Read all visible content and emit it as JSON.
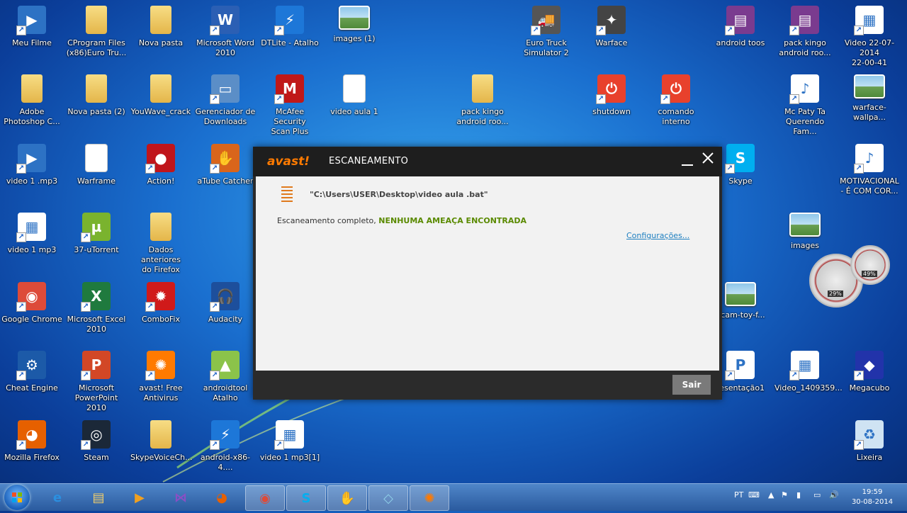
{
  "desktop": {
    "icons": [
      {
        "label": "Meu Filme",
        "name": "meu-filme-icon",
        "color": "#2d72c4",
        "glyph": "▶"
      },
      {
        "label": "CProgram Files\n(x86)Euro Tru...",
        "name": "folder-icon",
        "color": "#e4b64a",
        "glyph": ""
      },
      {
        "label": "Nova pasta",
        "name": "folder-icon",
        "color": "#e4b64a",
        "glyph": ""
      },
      {
        "label": "Microsoft Word\n2010",
        "name": "word-icon",
        "color": "#2b5fb4",
        "glyph": "W"
      },
      {
        "label": "DTLite - Atalho",
        "name": "daemon-tools-icon",
        "color": "#1d77d8",
        "glyph": "⚡"
      },
      {
        "label": "images (1)",
        "name": "image-file-icon",
        "color": "#8fc7ea",
        "glyph": ""
      },
      {
        "label": "Euro Truck\nSimulator 2",
        "name": "truck-icon",
        "color": "#555555",
        "glyph": "🚚"
      },
      {
        "label": "Warface",
        "name": "warface-icon",
        "color": "#444444",
        "glyph": "✦"
      },
      {
        "label": "android toos",
        "name": "archive-icon",
        "color": "#7a3b8f",
        "glyph": "▤"
      },
      {
        "label": "pack kingo\nandroid roo...",
        "name": "archive-icon",
        "color": "#7a3b8f",
        "glyph": "▤"
      },
      {
        "label": "Video 22-07-2014\n22-00-41",
        "name": "video-file-icon",
        "color": "#ffffff",
        "glyph": "▦"
      },
      {
        "label": "Adobe\nPhotoshop C...",
        "name": "folder-icon",
        "color": "#e4b64a",
        "glyph": ""
      },
      {
        "label": "Nova pasta (2)",
        "name": "folder-icon",
        "color": "#e4b64a",
        "glyph": ""
      },
      {
        "label": "YouWave_crack",
        "name": "folder-icon",
        "color": "#e4b64a",
        "glyph": ""
      },
      {
        "label": "Gerenciador de\nDownloads",
        "name": "download-manager-icon",
        "color": "#5b8ec7",
        "glyph": "▭"
      },
      {
        "label": "McAfee Security\nScan Plus",
        "name": "mcafee-icon",
        "color": "#c01818",
        "glyph": "M"
      },
      {
        "label": "video aula 1",
        "name": "text-file-icon",
        "color": "#ffffff",
        "glyph": ""
      },
      {
        "label": "pack kingo\nandroid roo...",
        "name": "folder-icon",
        "color": "#e4b64a",
        "glyph": ""
      },
      {
        "label": "shutdown",
        "name": "shutdown-icon",
        "color": "#e8412c",
        "glyph": "⏻"
      },
      {
        "label": "comando interno",
        "name": "shutdown-icon",
        "color": "#e8412c",
        "glyph": "⏻"
      },
      {
        "label": "Mc Paty  Ta\nQuerendo Fam...",
        "name": "audio-file-icon",
        "color": "#ffffff",
        "glyph": "♪"
      },
      {
        "label": "warface-wallpa...",
        "name": "image-file-icon",
        "color": "#8fc7ea",
        "glyph": ""
      },
      {
        "label": "video 1 .mp3",
        "name": "media-icon",
        "color": "#2d72c4",
        "glyph": "▶"
      },
      {
        "label": "Warframe",
        "name": "text-file-icon",
        "color": "#ffffff",
        "glyph": ""
      },
      {
        "label": "Action!",
        "name": "action-record-icon",
        "color": "#c0151b",
        "glyph": "●"
      },
      {
        "label": "aTube Catcher",
        "name": "atube-catcher-icon",
        "color": "#d9651b",
        "glyph": "✋"
      },
      {
        "label": "Skype",
        "name": "skype-icon",
        "color": "#00aff0",
        "glyph": "S"
      },
      {
        "label": "MOTIVACIONAL\n- É COM COR...",
        "name": "audio-file-icon",
        "color": "#ffffff",
        "glyph": "♪"
      },
      {
        "label": "video 1 mp3",
        "name": "wmv-file-icon",
        "color": "#ffffff",
        "glyph": "▦"
      },
      {
        "label": "37-uTorrent",
        "name": "utorrent-icon",
        "color": "#7ab32e",
        "glyph": "µ"
      },
      {
        "label": "Dados anteriores\ndo Firefox",
        "name": "folder-icon",
        "color": "#e4b64a",
        "glyph": ""
      },
      {
        "label": "images",
        "name": "image-file-icon",
        "color": "#8fc7ea",
        "glyph": ""
      },
      {
        "label": "Google Chrome",
        "name": "chrome-icon",
        "color": "#dd4b39",
        "glyph": "◉"
      },
      {
        "label": "Microsoft Excel\n2010",
        "name": "excel-icon",
        "color": "#1f7a3e",
        "glyph": "X"
      },
      {
        "label": "ComboFix",
        "name": "combofix-icon",
        "color": "#d01a1a",
        "glyph": "✹"
      },
      {
        "label": "Audacity",
        "name": "audacity-icon",
        "color": "#1d4f9c",
        "glyph": "🎧"
      },
      {
        "label": "bcam-toy-f...",
        "name": "image-file-icon",
        "color": "#8fc7ea",
        "glyph": ""
      },
      {
        "label": "Cheat Engine",
        "name": "cheat-engine-icon",
        "color": "#1c5aa8",
        "glyph": "⚙"
      },
      {
        "label": "Microsoft\nPowerPoint 2010",
        "name": "powerpoint-icon",
        "color": "#d24726",
        "glyph": "P"
      },
      {
        "label": "avast! Free\nAntivirus",
        "name": "avast-icon",
        "color": "#ff7a00",
        "glyph": "✺"
      },
      {
        "label": "androidtool\nAtalho",
        "name": "android-icon",
        "color": "#8bc34a",
        "glyph": "▲"
      },
      {
        "label": "resentação1",
        "name": "powerpoint-file-icon",
        "color": "#ffffff",
        "glyph": "P"
      },
      {
        "label": "Video_1409359...",
        "name": "wmv-file-icon",
        "color": "#ffffff",
        "glyph": "▦"
      },
      {
        "label": "Megacubo",
        "name": "megacubo-icon",
        "color": "#2233aa",
        "glyph": "◆"
      },
      {
        "label": "Mozilla Firefox",
        "name": "firefox-icon",
        "color": "#e66000",
        "glyph": "◕"
      },
      {
        "label": "Steam",
        "name": "steam-icon",
        "color": "#1b2838",
        "glyph": "◎"
      },
      {
        "label": "SkypeVoiceCh...",
        "name": "folder-icon",
        "color": "#e4b64a",
        "glyph": ""
      },
      {
        "label": "android-x86-4....",
        "name": "daemon-tools-icon",
        "color": "#1d77d8",
        "glyph": "⚡"
      },
      {
        "label": "video 1 mp3[1]",
        "name": "wmv-file-icon",
        "color": "#ffffff",
        "glyph": "▦"
      },
      {
        "label": "Lixeira",
        "name": "recycle-bin-icon",
        "color": "#cfe3f3",
        "glyph": "♻"
      }
    ]
  },
  "dialog": {
    "brand": "avast!",
    "title": "ESCANEAMENTO",
    "file_path": "\"C:\\Users\\USER\\Desktop\\video aula .bat\"",
    "status_prefix": "Escaneamento completo,",
    "status_result": "NENHUMA AMEAÇA ENCONTRADA",
    "config_link": "Configurações...",
    "exit_button": "Sair",
    "accent_color": "#ff7a00",
    "result_color": "#5a8a00"
  },
  "gadget": {
    "cpu": "29%",
    "memory": "49%"
  },
  "taskbar": {
    "pinned": [
      {
        "name": "internet-explorer-icon",
        "glyph": "e",
        "color": "#2b8fe0"
      },
      {
        "name": "explorer-icon",
        "glyph": "▤",
        "color": "#f3cf6a"
      },
      {
        "name": "media-player-icon",
        "glyph": "▶",
        "color": "#f0a020"
      },
      {
        "name": "visual-studio-icon",
        "glyph": "⋈",
        "color": "#8a4fc4"
      },
      {
        "name": "firefox-icon",
        "glyph": "◕",
        "color": "#e66000"
      },
      {
        "name": "chrome-icon",
        "glyph": "◉",
        "color": "#dd4b39"
      },
      {
        "name": "skype-icon",
        "glyph": "S",
        "color": "#00aff0"
      },
      {
        "name": "atube-catcher-icon",
        "glyph": "✋",
        "color": "#d9651b"
      },
      {
        "name": "generic-app-icon",
        "glyph": "◇",
        "color": "#8fd0e8"
      },
      {
        "name": "avast-icon",
        "glyph": "✺",
        "color": "#ff7a00"
      }
    ],
    "language": "PT",
    "time": "19:59",
    "date": "30-08-2014"
  }
}
